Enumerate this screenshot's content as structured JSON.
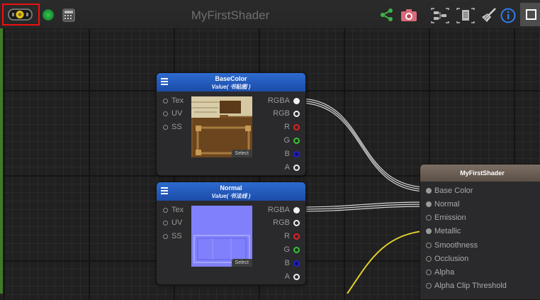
{
  "toolbar": {
    "title": "MyFirstShader",
    "left_icons": [
      "live-preview-toggle-icon",
      "status-dot-icon",
      "calculator-icon"
    ],
    "right_icons": [
      "share-icon",
      "camera-icon",
      "graph-layout-icon",
      "document-icon",
      "broom-icon",
      "info-icon",
      "maximize-icon"
    ],
    "status_color": "#1e8a35",
    "highlight_color": "#e11111"
  },
  "nodes": [
    {
      "title": "BaseColor",
      "subtitle": "Value( 书贴图 )",
      "inputs": [
        "Tex",
        "UV",
        "SS"
      ],
      "outputs": [
        "RGBA",
        "RGB",
        "R",
        "G",
        "B",
        "A"
      ],
      "select_label": "Select",
      "preview": "wood-texture"
    },
    {
      "title": "Normal",
      "subtitle": "Value( 书法线 )",
      "inputs": [
        "Tex",
        "UV",
        "SS"
      ],
      "outputs": [
        "RGBA",
        "RGB",
        "R",
        "G",
        "B",
        "A"
      ],
      "select_label": "Select",
      "preview": "normal-map-texture"
    }
  ],
  "master": {
    "title": "MyFirstShader",
    "inputs": [
      "Base Color",
      "Normal",
      "Emission",
      "Metallic",
      "Smoothness",
      "Occlusion",
      "Alpha",
      "Alpha Clip Threshold"
    ],
    "connected": [
      "Base Color",
      "Normal",
      "Metallic"
    ]
  },
  "colors": {
    "node_header": "#2e6bd0",
    "master_header": "#7d6f64",
    "wire": "#d8d8d8",
    "metallic_wire": "#e2d02a",
    "output_red": "#e02222",
    "output_green": "#33c433",
    "output_blue": "#2222cc"
  }
}
